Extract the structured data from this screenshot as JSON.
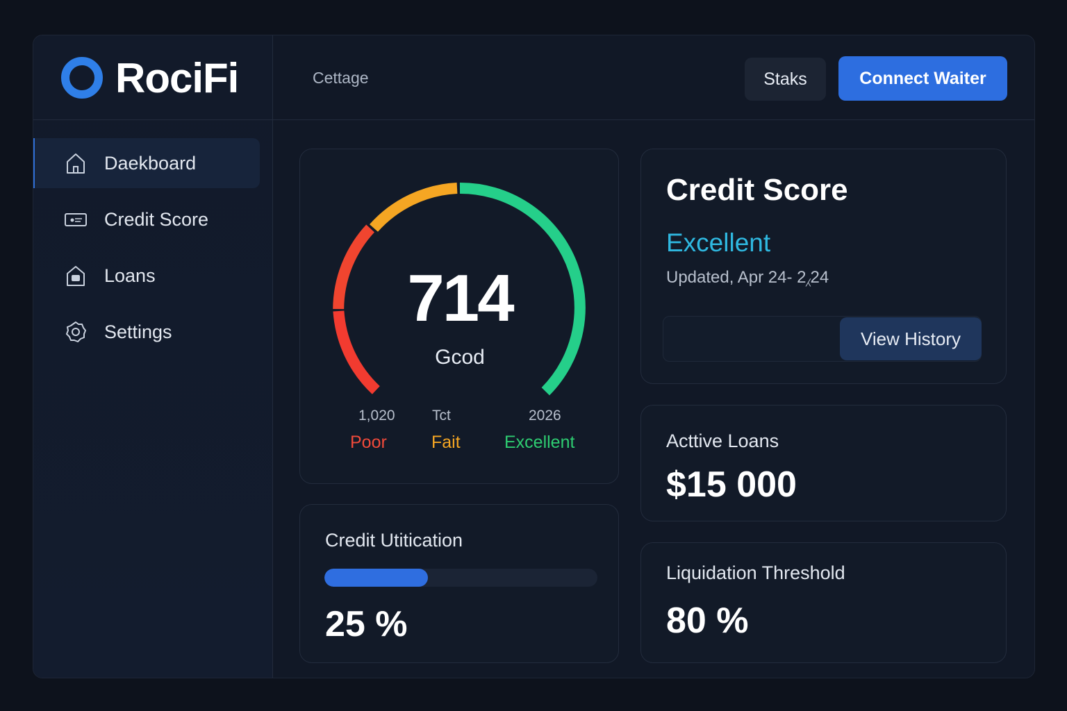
{
  "app": {
    "name": "RociFi",
    "brand_color": "#2f7fe8"
  },
  "topbar": {
    "label": "Cettage",
    "staks_label": "Staks",
    "connect_label": "Connect Waiter"
  },
  "sidebar": {
    "items": [
      {
        "label": "Daekboard",
        "icon": "home-icon",
        "active": true
      },
      {
        "label": "Credit Score",
        "icon": "card-icon",
        "active": false
      },
      {
        "label": "Loans",
        "icon": "loan-icon",
        "active": false
      },
      {
        "label": "Settings",
        "icon": "gear-icon",
        "active": false
      }
    ]
  },
  "gauge": {
    "score": "714",
    "rating": "Gcod",
    "tick_labels": [
      "1,020",
      "Tct",
      "2026"
    ],
    "zones": [
      {
        "label": "Poor",
        "color": "#f04a3a"
      },
      {
        "label": "Fait",
        "color": "#f5a623"
      },
      {
        "label": "Excellent",
        "color": "#2ecc71"
      }
    ]
  },
  "credit_score": {
    "title": "Credit Score",
    "rating": "Excellent",
    "rating_color": "#2fb8e0",
    "updated": "Updated, Apr 24- 2⁁24",
    "history_label": "View History"
  },
  "active_loans": {
    "label": "Acttive Loans",
    "value": "$15 000"
  },
  "liquidation": {
    "label": "Liquidation Threshold",
    "value": "80 %"
  },
  "utilization": {
    "label": "Credit Utitication",
    "value": "25 %",
    "fraction": 0.25
  }
}
